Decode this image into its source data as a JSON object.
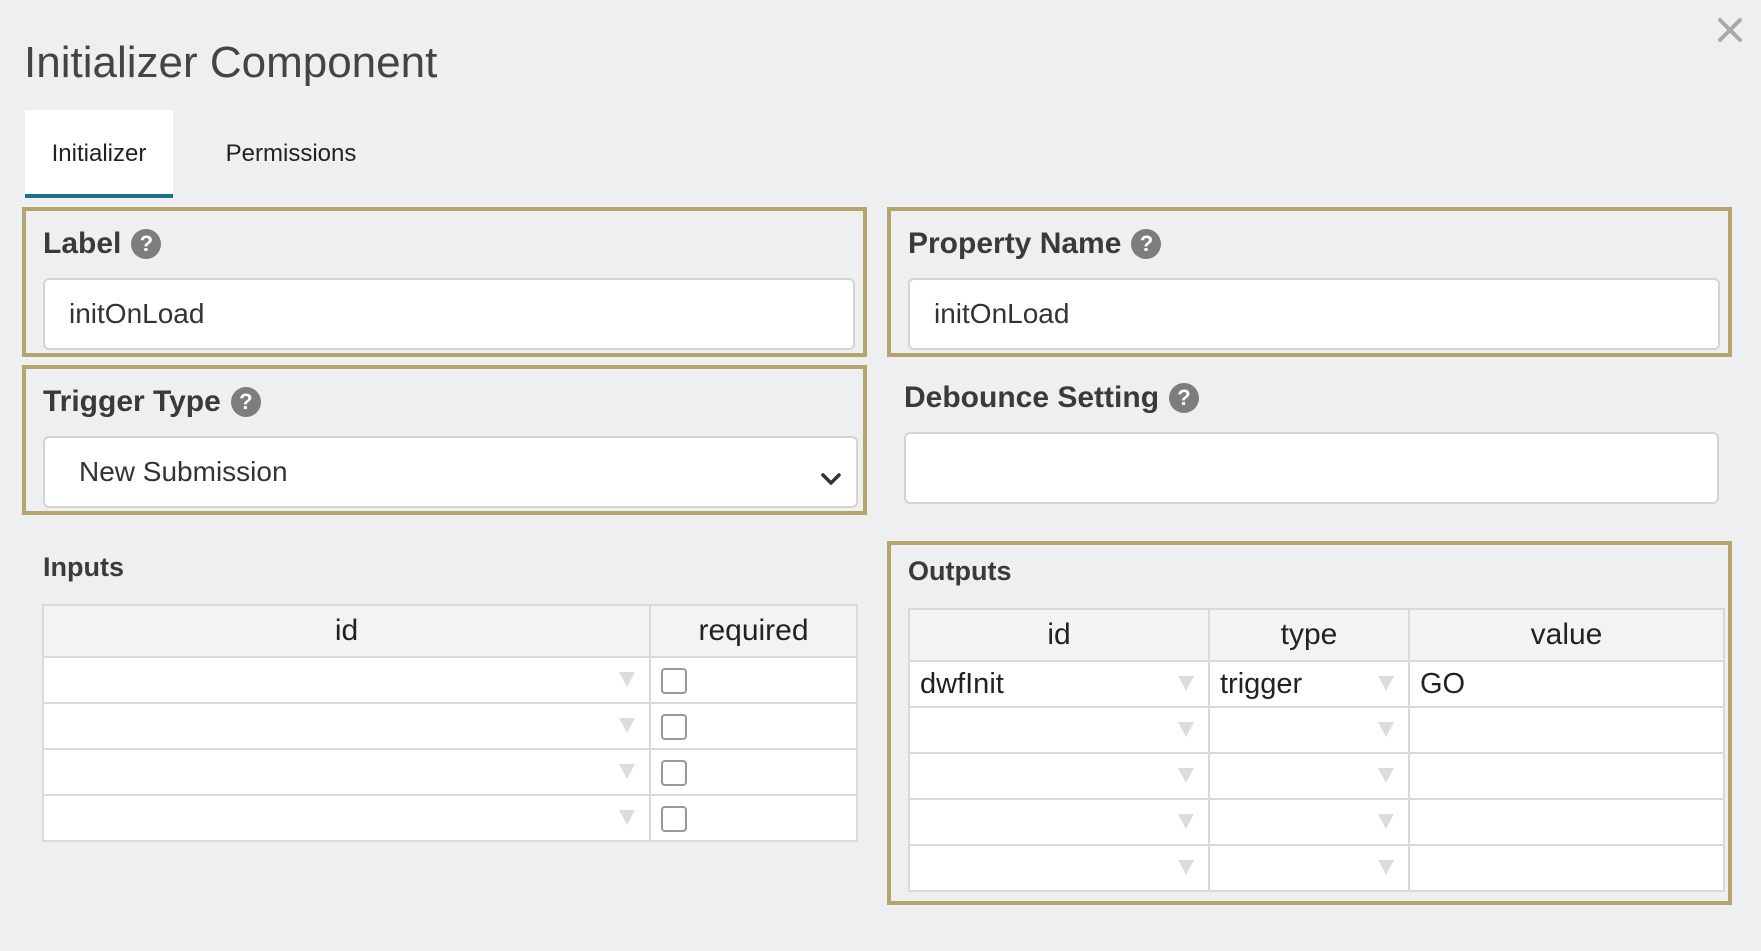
{
  "dialog": {
    "title": "Initializer Component"
  },
  "tabs": [
    {
      "label": "Initializer",
      "active": true
    },
    {
      "label": "Permissions",
      "active": false
    }
  ],
  "fields": {
    "label": {
      "title": "Label",
      "value": "initOnLoad"
    },
    "property_name": {
      "title": "Property Name",
      "value": "initOnLoad"
    },
    "trigger_type": {
      "title": "Trigger Type",
      "value": "New Submission"
    },
    "debounce": {
      "title": "Debounce Setting",
      "value": ""
    }
  },
  "inputs": {
    "title": "Inputs",
    "columns": [
      "id",
      "required"
    ],
    "rows": [
      {
        "id": "",
        "required": false
      },
      {
        "id": "",
        "required": false
      },
      {
        "id": "",
        "required": false
      },
      {
        "id": "",
        "required": false
      }
    ]
  },
  "outputs": {
    "title": "Outputs",
    "columns": [
      "id",
      "type",
      "value"
    ],
    "rows": [
      {
        "id": "dwfInit",
        "type": "trigger",
        "value": "GO"
      },
      {
        "id": "",
        "type": "",
        "value": ""
      },
      {
        "id": "",
        "type": "",
        "value": ""
      },
      {
        "id": "",
        "type": "",
        "value": ""
      },
      {
        "id": "",
        "type": "",
        "value": ""
      }
    ]
  },
  "colors": {
    "highlight_border": "#b5a56c",
    "tab_active_underline": "#1f7090",
    "background": "#eeeff1"
  },
  "icons": {
    "help": "question-circle-icon",
    "close": "close-icon",
    "dropdown": "chevron-down-icon"
  }
}
